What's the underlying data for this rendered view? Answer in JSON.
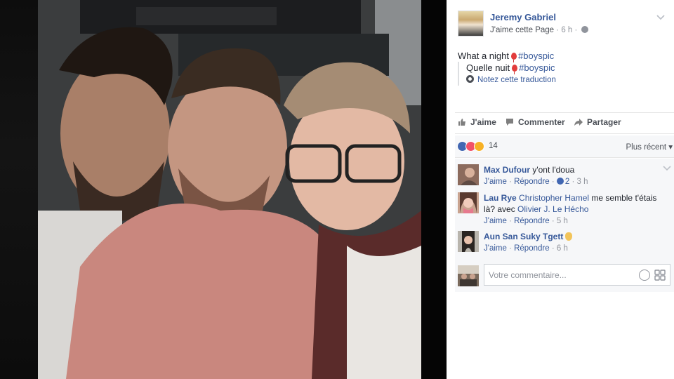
{
  "post": {
    "author_name": "Jeremy Gabriel",
    "page_like": "J'aime cette Page",
    "dot": "·",
    "time": "6 h",
    "text_before": "What a night",
    "hashtag": "#boyspic",
    "translation_before": "Quelle nuit",
    "translation_hashtag": "#boyspic",
    "rate_translation": "Notez cette traduction"
  },
  "actions": {
    "like": "J'aime",
    "comment": "Commenter",
    "share": "Partager"
  },
  "reactions": {
    "count": "14",
    "sort": "Plus récent"
  },
  "comments": [
    {
      "name": "Max Dufour",
      "text": "y'ont l'doua",
      "like": "J'aime",
      "reply": "Répondre",
      "likes_count": "2",
      "time": "3 h"
    },
    {
      "name": "Lau Rye",
      "tag1": "Christopher Hamel",
      "text": "me semble t'étais là? avec",
      "tag2": "Olivier J. Le Hécho",
      "like": "J'aime",
      "reply": "Répondre",
      "time": "5 h"
    },
    {
      "name": "Aun San Suky Tgett",
      "text": "",
      "like": "J'aime",
      "reply": "Répondre",
      "time": "6 h"
    }
  ],
  "composer": {
    "placeholder": "Votre commentaire..."
  },
  "colors": {
    "link": "#365899",
    "meta": "#90949c",
    "like_blue": "#4267b2",
    "love_red": "#f25268",
    "sad_yellow": "#f7b125"
  }
}
